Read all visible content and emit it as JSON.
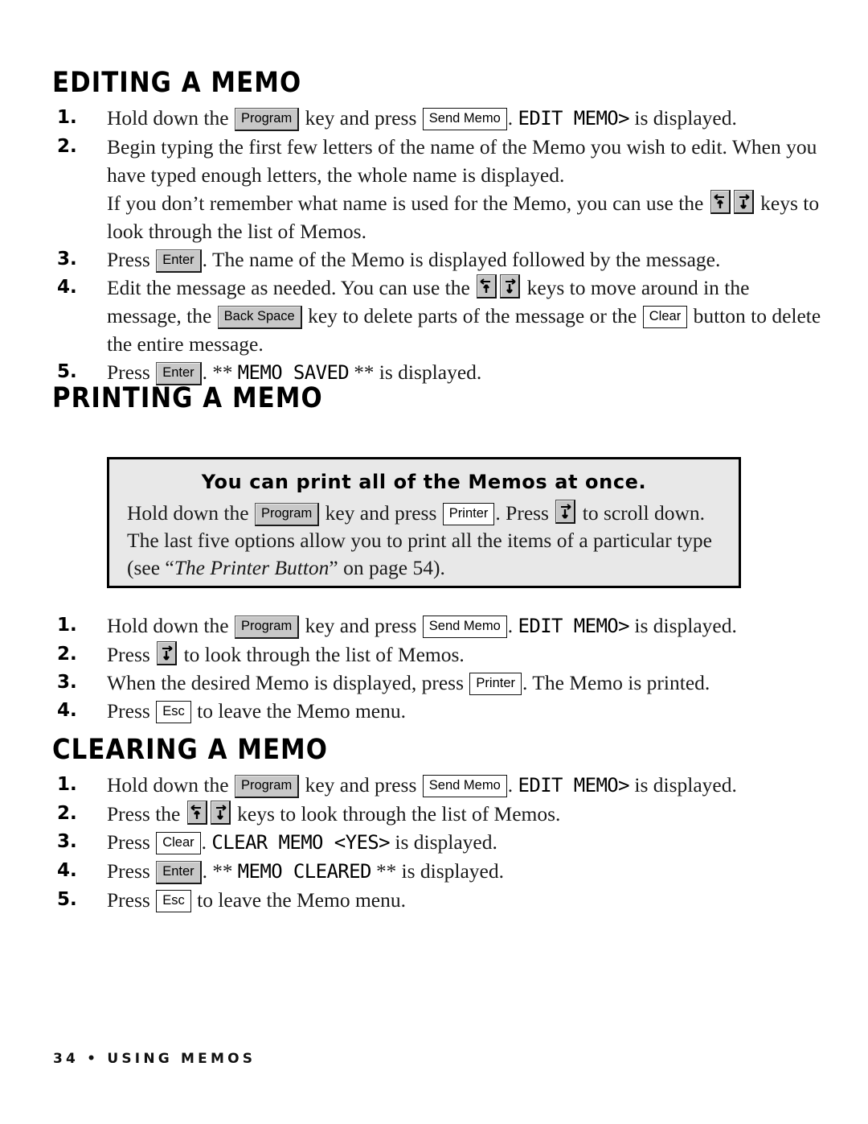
{
  "page": {
    "footer": "34 • USING MEMOS"
  },
  "keys": {
    "program": "Program",
    "send_memo": "Send Memo",
    "enter": "Enter",
    "back_space": "Back Space",
    "clear": "Clear",
    "printer": "Printer",
    "esc": "Esc"
  },
  "icons": {
    "left_up_arrow_key": "left-up-arrow-key-icon",
    "right_down_arrow_key": "right-down-arrow-key-icon"
  },
  "sections": [
    {
      "id": "editing-a-memo",
      "heading": "EDITING A MEMO",
      "steps": [
        {
          "num": "1.",
          "parts": [
            {
              "t": "text",
              "v": "Hold down the "
            },
            {
              "t": "key-gray",
              "v": "Program"
            },
            {
              "t": "text",
              "v": " key and press "
            },
            {
              "t": "key-white",
              "v": "Send Memo"
            },
            {
              "t": "text",
              "v": ". "
            },
            {
              "t": "lcd",
              "v": "EDIT MEMO>"
            },
            {
              "t": "text",
              "v": " is displayed."
            }
          ]
        },
        {
          "num": "2.",
          "parts": [
            {
              "t": "text",
              "v": "Begin typing the first few letters of the name of the Memo you wish to edit. When you have typed enough letters, the whole name is displayed."
            }
          ],
          "sub": [
            {
              "t": "text",
              "v": "If you don’t remember what name is used for the Memo, you can use the "
            },
            {
              "t": "akey-lu",
              "v": "left-up-arrow-key-icon"
            },
            {
              "t": "akey-rd",
              "v": "right-down-arrow-key-icon"
            },
            {
              "t": "text",
              "v": " keys to look through the list of Memos."
            }
          ]
        },
        {
          "num": "3.",
          "parts": [
            {
              "t": "text",
              "v": "Press "
            },
            {
              "t": "key-gray",
              "v": "Enter"
            },
            {
              "t": "text",
              "v": ". The name of the Memo is displayed followed by the message."
            }
          ]
        },
        {
          "num": "4.",
          "parts": [
            {
              "t": "text",
              "v": "Edit the message as needed. You can use the "
            },
            {
              "t": "akey-lu",
              "v": "left-up-arrow-key-icon"
            },
            {
              "t": "akey-rd",
              "v": "right-down-arrow-key-icon"
            },
            {
              "t": "text",
              "v": " keys to move around in the message, the "
            },
            {
              "t": "key-gray",
              "v": "Back Space"
            },
            {
              "t": "text",
              "v": " key to delete parts of the message or the "
            },
            {
              "t": "key-white",
              "v": "Clear"
            },
            {
              "t": "text",
              "v": " button to delete the entire message."
            }
          ]
        },
        {
          "num": "5.",
          "parts": [
            {
              "t": "text",
              "v": "Press "
            },
            {
              "t": "key-gray",
              "v": "Enter"
            },
            {
              "t": "text",
              "v": ". "
            },
            {
              "t": "stars",
              "v": "** "
            },
            {
              "t": "lcd",
              "v": "MEMO SAVED"
            },
            {
              "t": "stars",
              "v": " **"
            },
            {
              "t": "text",
              "v": " is displayed."
            }
          ]
        }
      ]
    },
    {
      "id": "printing-a-memo",
      "heading": "PRINTING A MEMO",
      "callout": {
        "title": "You can print all of the Memos at once.",
        "lines": [
          [
            {
              "t": "text",
              "v": "Hold down the "
            },
            {
              "t": "key-gray",
              "v": "Program"
            },
            {
              "t": "text",
              "v": " key and press "
            },
            {
              "t": "key-white",
              "v": "Printer"
            },
            {
              "t": "text",
              "v": ". Press "
            },
            {
              "t": "akey-rd",
              "v": "right-down-arrow-key-icon"
            },
            {
              "t": "text",
              "v": " to scroll down."
            }
          ],
          [
            {
              "t": "text",
              "v": "The last five options allow you to print all the items of a particular type"
            }
          ],
          [
            {
              "t": "text",
              "v": "(see “"
            },
            {
              "t": "ital",
              "v": "The Printer Button"
            },
            {
              "t": "text",
              "v": "” on page 54)."
            }
          ]
        ]
      },
      "steps": [
        {
          "num": "1.",
          "parts": [
            {
              "t": "text",
              "v": "Hold down the "
            },
            {
              "t": "key-gray",
              "v": "Program"
            },
            {
              "t": "text",
              "v": " key and press "
            },
            {
              "t": "key-white",
              "v": "Send Memo"
            },
            {
              "t": "text",
              "v": ". "
            },
            {
              "t": "lcd",
              "v": "EDIT MEMO>"
            },
            {
              "t": "text",
              "v": " is displayed."
            }
          ]
        },
        {
          "num": "2.",
          "parts": [
            {
              "t": "text",
              "v": "Press "
            },
            {
              "t": "akey-rd",
              "v": "right-down-arrow-key-icon"
            },
            {
              "t": "text",
              "v": " to look through the list of Memos."
            }
          ]
        },
        {
          "num": "3.",
          "parts": [
            {
              "t": "text",
              "v": "When the desired Memo is displayed, press "
            },
            {
              "t": "key-white",
              "v": "Printer"
            },
            {
              "t": "text",
              "v": ". The Memo is printed."
            }
          ]
        },
        {
          "num": "4.",
          "parts": [
            {
              "t": "text",
              "v": "Press "
            },
            {
              "t": "key-white",
              "v": "Esc"
            },
            {
              "t": "text",
              "v": " to leave the Memo menu."
            }
          ]
        }
      ]
    },
    {
      "id": "clearing-a-memo",
      "heading": "CLEARING A MEMO",
      "steps": [
        {
          "num": "1.",
          "parts": [
            {
              "t": "text",
              "v": "Hold down the "
            },
            {
              "t": "key-gray",
              "v": "Program"
            },
            {
              "t": "text",
              "v": " key and press "
            },
            {
              "t": "key-white",
              "v": "Send Memo"
            },
            {
              "t": "text",
              "v": ". "
            },
            {
              "t": "lcd",
              "v": "EDIT MEMO>"
            },
            {
              "t": "text",
              "v": " is displayed."
            }
          ]
        },
        {
          "num": "2.",
          "parts": [
            {
              "t": "text",
              "v": "Press the "
            },
            {
              "t": "akey-lu",
              "v": "left-up-arrow-key-icon"
            },
            {
              "t": "akey-rd",
              "v": "right-down-arrow-key-icon"
            },
            {
              "t": "text",
              "v": " keys to look through the list of Memos."
            }
          ]
        },
        {
          "num": "3.",
          "parts": [
            {
              "t": "text",
              "v": "Press "
            },
            {
              "t": "key-white",
              "v": "Clear"
            },
            {
              "t": "text",
              "v": ". "
            },
            {
              "t": "lcd",
              "v": "CLEAR MEMO <YES>"
            },
            {
              "t": "text",
              "v": " is displayed."
            }
          ]
        },
        {
          "num": "4.",
          "parts": [
            {
              "t": "text",
              "v": "Press "
            },
            {
              "t": "key-gray",
              "v": "Enter"
            },
            {
              "t": "text",
              "v": ". "
            },
            {
              "t": "stars",
              "v": "** "
            },
            {
              "t": "lcd",
              "v": "MEMO CLEARED"
            },
            {
              "t": "stars",
              "v": " **"
            },
            {
              "t": "text",
              "v": " is displayed."
            }
          ]
        },
        {
          "num": "5.",
          "parts": [
            {
              "t": "text",
              "v": "Press "
            },
            {
              "t": "key-white",
              "v": "Esc"
            },
            {
              "t": "text",
              "v": " to leave the Memo menu."
            }
          ]
        }
      ]
    }
  ]
}
